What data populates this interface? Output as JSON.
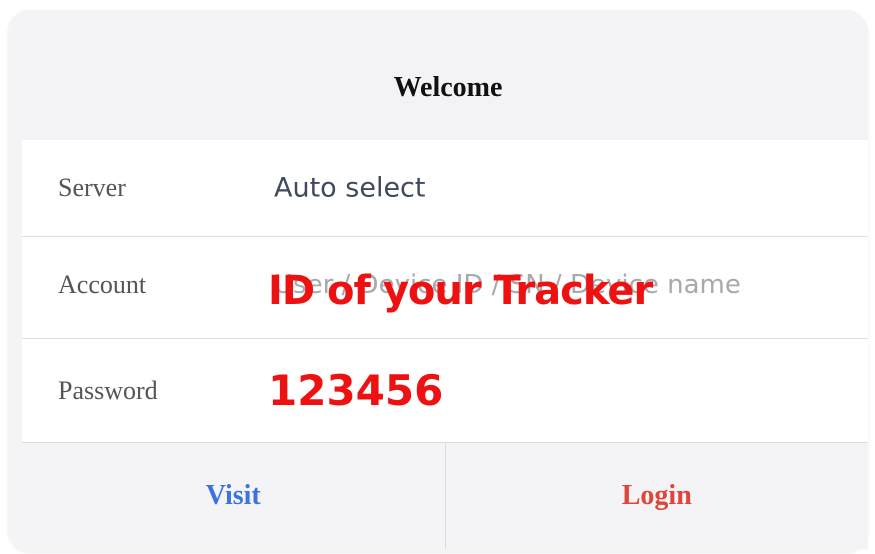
{
  "header": {
    "title": "Welcome"
  },
  "form": {
    "server": {
      "label": "Server",
      "value": "Auto select"
    },
    "account": {
      "label": "Account",
      "placeholder": "User / Device ID / SN / Device name",
      "overlay_text": "ID of your Tracker"
    },
    "password": {
      "label": "Password",
      "overlay_text": "123456"
    }
  },
  "footer": {
    "visit_label": "Visit",
    "login_label": "Login"
  },
  "colors": {
    "visit": "#3b74e0",
    "login": "#e0443a",
    "annotation": "#ee1111"
  }
}
